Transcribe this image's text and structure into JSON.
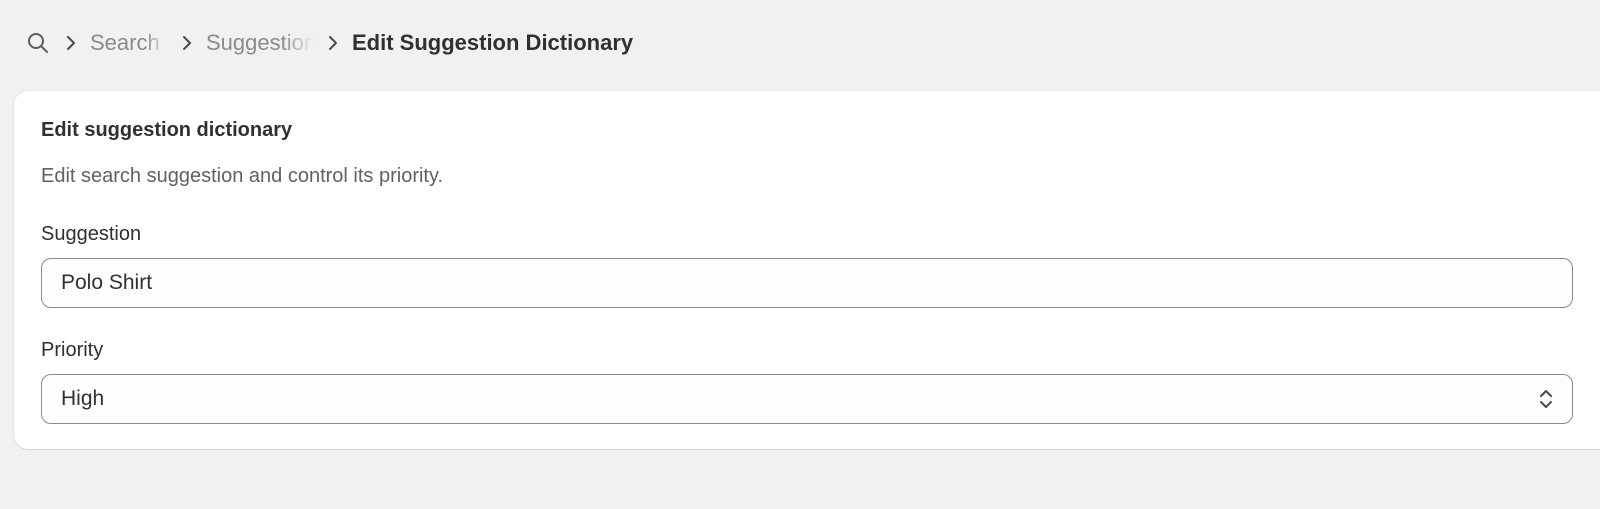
{
  "breadcrumb": {
    "items": [
      {
        "label": "Search"
      },
      {
        "label": "Suggestions"
      }
    ],
    "current": "Edit Suggestion Dictionary"
  },
  "card": {
    "title": "Edit suggestion dictionary",
    "description": "Edit search suggestion and control its priority.",
    "suggestion": {
      "label": "Suggestion",
      "value": "Polo Shirt"
    },
    "priority": {
      "label": "Priority",
      "selected": "High"
    }
  },
  "colors": {
    "background": "#f1f1f1",
    "card": "#ffffff",
    "text": "#303030",
    "muted_text": "#8a8a8a",
    "border": "#8a8a8a"
  },
  "icons": {
    "search": "search-icon",
    "chevron": "chevron-right-icon",
    "select": "chevron-up-down-icon"
  }
}
